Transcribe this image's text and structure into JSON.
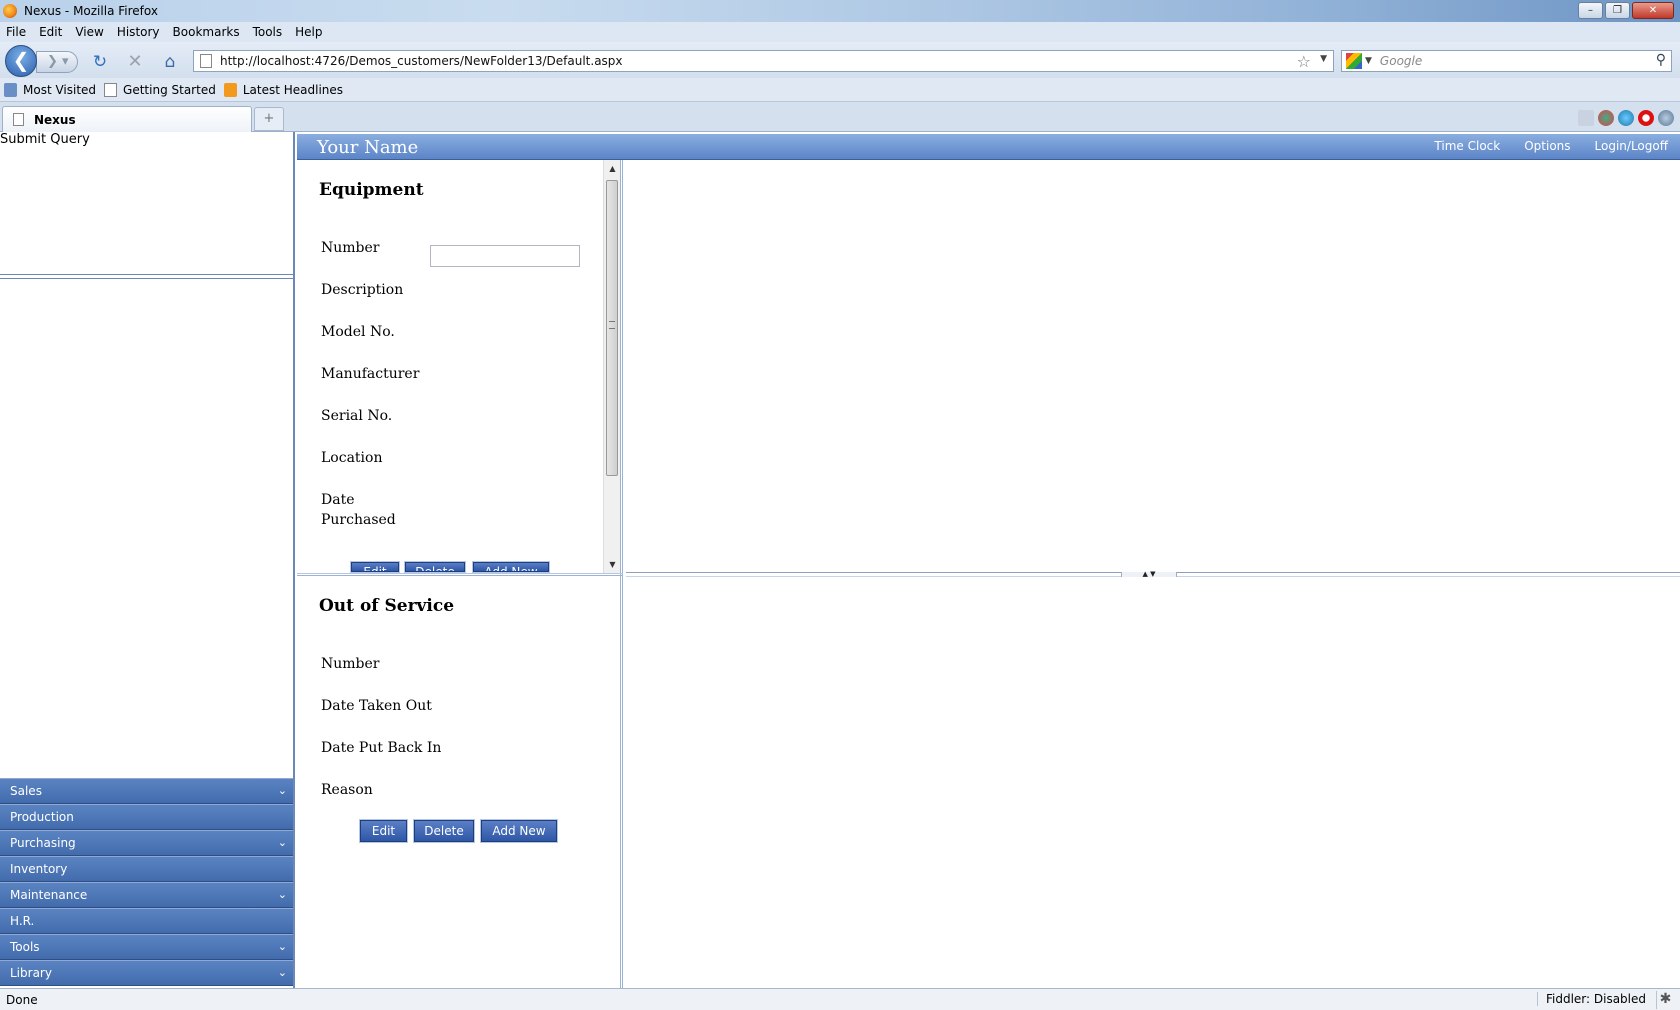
{
  "window": {
    "title": "Nexus - Mozilla Firefox",
    "controls": {
      "minimize": "–",
      "maximize": "❐",
      "close": "✕"
    }
  },
  "menu": [
    "File",
    "Edit",
    "View",
    "History",
    "Bookmarks",
    "Tools",
    "Help"
  ],
  "toolbar": {
    "url": "http://localhost:4726/Demos_customers/NewFolder13/Default.aspx",
    "search_placeholder": "Google",
    "back_glyph": "❮",
    "forward_glyph": "❯ ▾",
    "reload_glyph": "↻",
    "stop_glyph": "✕",
    "home_glyph": "⌂",
    "bookmark_star": "☆",
    "url_dropdown": "▼",
    "search_glyph": "⚲"
  },
  "bookmarks": [
    "Most Visited",
    "Getting Started",
    "Latest Headlines"
  ],
  "tabs": {
    "active": "Nexus",
    "new_tab": "+"
  },
  "left": {
    "submit_label": "Submit Query",
    "accordion": [
      {
        "label": "Sales",
        "chevron": "⌄"
      },
      {
        "label": "Production",
        "chevron": ""
      },
      {
        "label": "Purchasing",
        "chevron": "⌄"
      },
      {
        "label": "Inventory",
        "chevron": ""
      },
      {
        "label": "Maintenance",
        "chevron": "⌄"
      },
      {
        "label": "H.R.",
        "chevron": ""
      },
      {
        "label": "Tools",
        "chevron": "⌄"
      },
      {
        "label": "Library",
        "chevron": "⌄"
      }
    ]
  },
  "header": {
    "brand": "Your Name",
    "links": [
      "Time Clock",
      "Options",
      "Login/Logoff"
    ]
  },
  "equipment": {
    "title": "Equipment",
    "fields": [
      "Number",
      "Description",
      "Model No.",
      "Manufacturer",
      "Serial No.",
      "Location",
      "Date Purchased"
    ],
    "number_value": "",
    "buttons": [
      "Edit",
      "Delete",
      "Add New"
    ]
  },
  "out_of_service": {
    "title": "Out of Service",
    "fields": [
      "Number",
      "Date Taken Out",
      "Date Put Back In",
      "Reason"
    ],
    "buttons": [
      "Edit",
      "Delete",
      "Add New"
    ]
  },
  "status": {
    "text": "Done",
    "fiddler": "Fiddler: Disabled"
  },
  "colors": {
    "accent": "#4a72b5",
    "header_bar": "#6f96d2",
    "window_frame": "#b9d1ea"
  }
}
